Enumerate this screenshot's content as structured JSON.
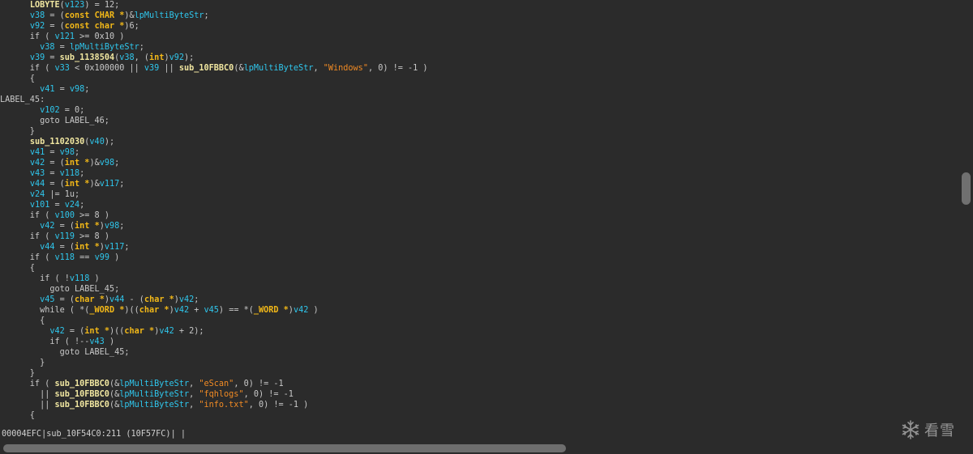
{
  "code_lines": [
    [
      {
        "t": "      ",
        "c": "p"
      },
      {
        "t": "LOBYTE",
        "c": "f"
      },
      {
        "t": "(",
        "c": "p"
      },
      {
        "t": "v123",
        "c": "v"
      },
      {
        "t": ") = 12;",
        "c": "p"
      }
    ],
    [
      {
        "t": "      ",
        "c": "p"
      },
      {
        "t": "v38",
        "c": "v"
      },
      {
        "t": " = (",
        "c": "p"
      },
      {
        "t": "const CHAR *",
        "c": "k"
      },
      {
        "t": ")&",
        "c": "p"
      },
      {
        "t": "lpMultiByteStr",
        "c": "v"
      },
      {
        "t": ";",
        "c": "p"
      }
    ],
    [
      {
        "t": "      ",
        "c": "p"
      },
      {
        "t": "v92",
        "c": "v"
      },
      {
        "t": " = (",
        "c": "p"
      },
      {
        "t": "const char *",
        "c": "k"
      },
      {
        "t": ")6;",
        "c": "p"
      }
    ],
    [
      {
        "t": "      if ( ",
        "c": "p"
      },
      {
        "t": "v121",
        "c": "v"
      },
      {
        "t": " >= 0x10 )",
        "c": "p"
      }
    ],
    [
      {
        "t": "        ",
        "c": "p"
      },
      {
        "t": "v38",
        "c": "v"
      },
      {
        "t": " = ",
        "c": "p"
      },
      {
        "t": "lpMultiByteStr",
        "c": "v"
      },
      {
        "t": ";",
        "c": "p"
      }
    ],
    [
      {
        "t": "      ",
        "c": "p"
      },
      {
        "t": "v39",
        "c": "v"
      },
      {
        "t": " = ",
        "c": "p"
      },
      {
        "t": "sub_1138504",
        "c": "f"
      },
      {
        "t": "(",
        "c": "p"
      },
      {
        "t": "v38",
        "c": "v"
      },
      {
        "t": ", (",
        "c": "p"
      },
      {
        "t": "int",
        "c": "k"
      },
      {
        "t": ")",
        "c": "p"
      },
      {
        "t": "v92",
        "c": "v"
      },
      {
        "t": ");",
        "c": "p"
      }
    ],
    [
      {
        "t": "      if ( ",
        "c": "p"
      },
      {
        "t": "v33",
        "c": "v"
      },
      {
        "t": " < 0x100000 || ",
        "c": "p"
      },
      {
        "t": "v39",
        "c": "v"
      },
      {
        "t": " || ",
        "c": "p"
      },
      {
        "t": "sub_10FBBC0",
        "c": "f"
      },
      {
        "t": "(&",
        "c": "p"
      },
      {
        "t": "lpMultiByteStr",
        "c": "v"
      },
      {
        "t": ", ",
        "c": "p"
      },
      {
        "t": "\"Windows\"",
        "c": "s"
      },
      {
        "t": ", 0) != -1 )",
        "c": "p"
      }
    ],
    [
      {
        "t": "      {",
        "c": "p"
      }
    ],
    [
      {
        "t": "        ",
        "c": "p"
      },
      {
        "t": "v41",
        "c": "v"
      },
      {
        "t": " = ",
        "c": "p"
      },
      {
        "t": "v98",
        "c": "v"
      },
      {
        "t": ";",
        "c": "p"
      }
    ],
    [
      {
        "t": "LABEL_45:",
        "c": "l"
      }
    ],
    [
      {
        "t": "        ",
        "c": "p"
      },
      {
        "t": "v102",
        "c": "v"
      },
      {
        "t": " = 0;",
        "c": "p"
      }
    ],
    [
      {
        "t": "        goto LABEL_46;",
        "c": "p"
      }
    ],
    [
      {
        "t": "      }",
        "c": "p"
      }
    ],
    [
      {
        "t": "      ",
        "c": "p"
      },
      {
        "t": "sub_1102030",
        "c": "f"
      },
      {
        "t": "(",
        "c": "p"
      },
      {
        "t": "v40",
        "c": "v"
      },
      {
        "t": ");",
        "c": "p"
      }
    ],
    [
      {
        "t": "      ",
        "c": "p"
      },
      {
        "t": "v41",
        "c": "v"
      },
      {
        "t": " = ",
        "c": "p"
      },
      {
        "t": "v98",
        "c": "v"
      },
      {
        "t": ";",
        "c": "p"
      }
    ],
    [
      {
        "t": "      ",
        "c": "p"
      },
      {
        "t": "v42",
        "c": "v"
      },
      {
        "t": " = (",
        "c": "p"
      },
      {
        "t": "int *",
        "c": "k"
      },
      {
        "t": ")&",
        "c": "p"
      },
      {
        "t": "v98",
        "c": "v"
      },
      {
        "t": ";",
        "c": "p"
      }
    ],
    [
      {
        "t": "      ",
        "c": "p"
      },
      {
        "t": "v43",
        "c": "v"
      },
      {
        "t": " = ",
        "c": "p"
      },
      {
        "t": "v118",
        "c": "v"
      },
      {
        "t": ";",
        "c": "p"
      }
    ],
    [
      {
        "t": "      ",
        "c": "p"
      },
      {
        "t": "v44",
        "c": "v"
      },
      {
        "t": " = (",
        "c": "p"
      },
      {
        "t": "int *",
        "c": "k"
      },
      {
        "t": ")&",
        "c": "p"
      },
      {
        "t": "v117",
        "c": "v"
      },
      {
        "t": ";",
        "c": "p"
      }
    ],
    [
      {
        "t": "      ",
        "c": "p"
      },
      {
        "t": "v24",
        "c": "v"
      },
      {
        "t": " |= 1u;",
        "c": "p"
      }
    ],
    [
      {
        "t": "      ",
        "c": "p"
      },
      {
        "t": "v101",
        "c": "v"
      },
      {
        "t": " = ",
        "c": "p"
      },
      {
        "t": "v24",
        "c": "v"
      },
      {
        "t": ";",
        "c": "p"
      }
    ],
    [
      {
        "t": "      if ( ",
        "c": "p"
      },
      {
        "t": "v100",
        "c": "v"
      },
      {
        "t": " >= 8 )",
        "c": "p"
      }
    ],
    [
      {
        "t": "        ",
        "c": "p"
      },
      {
        "t": "v42",
        "c": "v"
      },
      {
        "t": " = (",
        "c": "p"
      },
      {
        "t": "int *",
        "c": "k"
      },
      {
        "t": ")",
        "c": "p"
      },
      {
        "t": "v98",
        "c": "v"
      },
      {
        "t": ";",
        "c": "p"
      }
    ],
    [
      {
        "t": "      if ( ",
        "c": "p"
      },
      {
        "t": "v119",
        "c": "v"
      },
      {
        "t": " >= 8 )",
        "c": "p"
      }
    ],
    [
      {
        "t": "        ",
        "c": "p"
      },
      {
        "t": "v44",
        "c": "v"
      },
      {
        "t": " = (",
        "c": "p"
      },
      {
        "t": "int *",
        "c": "k"
      },
      {
        "t": ")",
        "c": "p"
      },
      {
        "t": "v117",
        "c": "v"
      },
      {
        "t": ";",
        "c": "p"
      }
    ],
    [
      {
        "t": "      if ( ",
        "c": "p"
      },
      {
        "t": "v118",
        "c": "v"
      },
      {
        "t": " == ",
        "c": "p"
      },
      {
        "t": "v99",
        "c": "v"
      },
      {
        "t": " )",
        "c": "p"
      }
    ],
    [
      {
        "t": "      {",
        "c": "p"
      }
    ],
    [
      {
        "t": "        if ( !",
        "c": "p"
      },
      {
        "t": "v118",
        "c": "v"
      },
      {
        "t": " )",
        "c": "p"
      }
    ],
    [
      {
        "t": "          goto LABEL_45;",
        "c": "p"
      }
    ],
    [
      {
        "t": "        ",
        "c": "p"
      },
      {
        "t": "v45",
        "c": "v"
      },
      {
        "t": " = (",
        "c": "p"
      },
      {
        "t": "char *",
        "c": "k"
      },
      {
        "t": ")",
        "c": "p"
      },
      {
        "t": "v44",
        "c": "v"
      },
      {
        "t": " - (",
        "c": "p"
      },
      {
        "t": "char *",
        "c": "k"
      },
      {
        "t": ")",
        "c": "p"
      },
      {
        "t": "v42",
        "c": "v"
      },
      {
        "t": ";",
        "c": "p"
      }
    ],
    [
      {
        "t": "        while ( *(",
        "c": "p"
      },
      {
        "t": "_WORD *",
        "c": "k"
      },
      {
        "t": ")((",
        "c": "p"
      },
      {
        "t": "char *",
        "c": "k"
      },
      {
        "t": ")",
        "c": "p"
      },
      {
        "t": "v42",
        "c": "v"
      },
      {
        "t": " + ",
        "c": "p"
      },
      {
        "t": "v45",
        "c": "v"
      },
      {
        "t": ") == *(",
        "c": "p"
      },
      {
        "t": "_WORD *",
        "c": "k"
      },
      {
        "t": ")",
        "c": "p"
      },
      {
        "t": "v42",
        "c": "v"
      },
      {
        "t": " )",
        "c": "p"
      }
    ],
    [
      {
        "t": "        {",
        "c": "p"
      }
    ],
    [
      {
        "t": "          ",
        "c": "p"
      },
      {
        "t": "v42",
        "c": "v"
      },
      {
        "t": " = (",
        "c": "p"
      },
      {
        "t": "int *",
        "c": "k"
      },
      {
        "t": ")((",
        "c": "p"
      },
      {
        "t": "char *",
        "c": "k"
      },
      {
        "t": ")",
        "c": "p"
      },
      {
        "t": "v42",
        "c": "v"
      },
      {
        "t": " + 2);",
        "c": "p"
      }
    ],
    [
      {
        "t": "          if ( !--",
        "c": "p"
      },
      {
        "t": "v43",
        "c": "v"
      },
      {
        "t": " )",
        "c": "p"
      }
    ],
    [
      {
        "t": "            goto LABEL_45;",
        "c": "p"
      }
    ],
    [
      {
        "t": "        }",
        "c": "p"
      }
    ],
    [
      {
        "t": "      }",
        "c": "p"
      }
    ],
    [
      {
        "t": "      if ( ",
        "c": "p"
      },
      {
        "t": "sub_10FBBC0",
        "c": "f"
      },
      {
        "t": "(&",
        "c": "p"
      },
      {
        "t": "lpMultiByteStr",
        "c": "v"
      },
      {
        "t": ", ",
        "c": "p"
      },
      {
        "t": "\"eScan\"",
        "c": "s"
      },
      {
        "t": ", 0) != -1",
        "c": "p"
      }
    ],
    [
      {
        "t": "        || ",
        "c": "p"
      },
      {
        "t": "sub_10FBBC0",
        "c": "f"
      },
      {
        "t": "(&",
        "c": "p"
      },
      {
        "t": "lpMultiByteStr",
        "c": "v"
      },
      {
        "t": ", ",
        "c": "p"
      },
      {
        "t": "\"fqhlogs\"",
        "c": "s"
      },
      {
        "t": ", 0) != -1",
        "c": "p"
      }
    ],
    [
      {
        "t": "        || ",
        "c": "p"
      },
      {
        "t": "sub_10FBBC0",
        "c": "f"
      },
      {
        "t": "(&",
        "c": "p"
      },
      {
        "t": "lpMultiByteStr",
        "c": "v"
      },
      {
        "t": ", ",
        "c": "p"
      },
      {
        "t": "\"info.txt\"",
        "c": "s"
      },
      {
        "t": ", 0) != -1 )",
        "c": "p"
      }
    ],
    [
      {
        "t": "      {",
        "c": "p"
      }
    ]
  ],
  "status_bar": {
    "address": "00004EFC",
    "location": "sub_10F54C0:211 (10F57FC)"
  },
  "watermark": {
    "text": "看雪",
    "icon": "snowflake-icon"
  },
  "colors": {
    "background": "#2b2b2b",
    "plain_text": "#c8c8c8",
    "variable": "#2fc6ec",
    "function": "#f0e6a0",
    "type_keyword": "#f2b818",
    "string": "#f08a24",
    "scrollbar_thumb": "#707070"
  }
}
